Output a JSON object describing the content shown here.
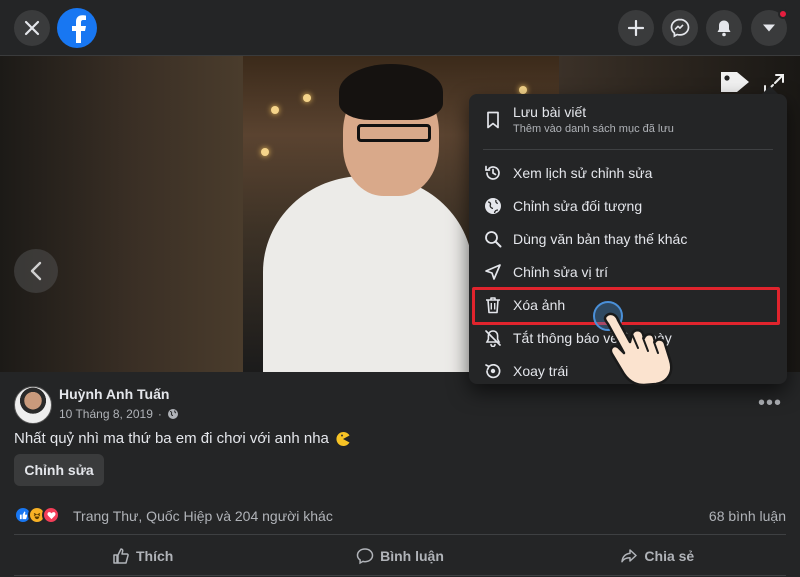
{
  "post": {
    "author": "Huỳnh Anh Tuấn",
    "date": "10 Tháng 8, 2019",
    "caption": "Nhất quỷ nhì ma thứ ba em đi chơi với anh nha",
    "edit_label": "Chỉnh sửa",
    "more_label": "•••",
    "reactions_text": "Trang Thư, Quốc Hiệp và 204 người khác",
    "comments_count": "68 bình luận"
  },
  "actions": {
    "like": "Thích",
    "comment": "Bình luận",
    "share": "Chia sẻ"
  },
  "menu": {
    "save": {
      "label": "Lưu bài viết",
      "sub": "Thêm vào danh sách mục đã lưu",
      "icon": "bookmark-icon"
    },
    "items": [
      {
        "label": "Xem lịch sử chỉnh sửa",
        "icon": "history-icon"
      },
      {
        "label": "Chỉnh sửa đối tượng",
        "icon": "globe-icon"
      },
      {
        "label": "Dùng văn bản thay thế khác",
        "icon": "search-icon"
      },
      {
        "label": "Chỉnh sửa vị trí",
        "icon": "location-arrow-icon"
      },
      {
        "label": "Xóa ảnh",
        "icon": "trash-icon"
      },
      {
        "label": "Tắt thông báo về ảnh này",
        "icon": "bell-off-icon"
      },
      {
        "label": "Xoay trái",
        "icon": "rotate-left-icon"
      }
    ]
  },
  "colors": {
    "facebook_blue": "#1877f2",
    "highlight_red": "#e0242d",
    "notification_red": "#e41e3f"
  }
}
